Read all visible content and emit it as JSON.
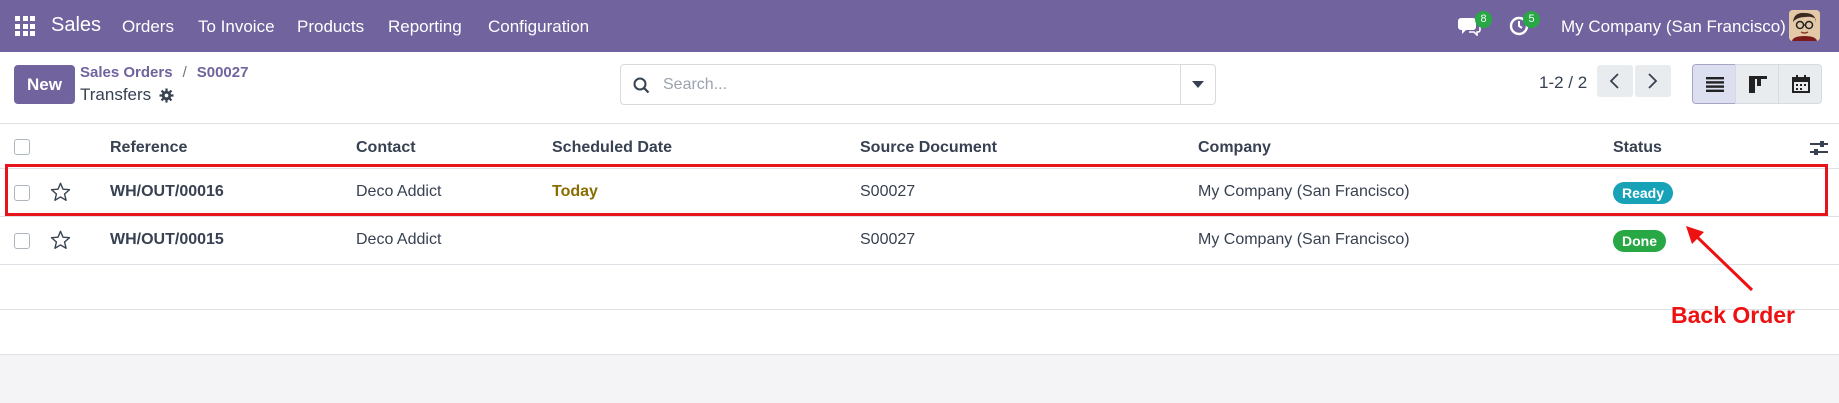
{
  "navbar": {
    "brand": "Sales",
    "menu": [
      "Orders",
      "To Invoice",
      "Products",
      "Reporting",
      "Configuration"
    ],
    "messages_count": "8",
    "activities_count": "5",
    "company": "My Company (San Francisco)"
  },
  "control": {
    "new_label": "New",
    "breadcrumb": [
      "Sales Orders",
      "S00027"
    ],
    "title": "Transfers",
    "search_placeholder": "Search...",
    "pager": "1-2 / 2"
  },
  "table": {
    "headers": [
      "Reference",
      "Contact",
      "Scheduled Date",
      "Source Document",
      "Company",
      "Status"
    ],
    "rows": [
      {
        "reference": "WH/OUT/00016",
        "contact": "Deco Addict",
        "scheduled": "Today",
        "source": "S00027",
        "company": "My Company (San Francisco)",
        "status": "Ready",
        "status_color": "#17a2b8"
      },
      {
        "reference": "WH/OUT/00015",
        "contact": "Deco Addict",
        "scheduled": "",
        "source": "S00027",
        "company": "My Company (San Francisco)",
        "status": "Done",
        "status_color": "#28a745"
      }
    ]
  },
  "annotation": {
    "label": "Back Order",
    "color": "#ee1111"
  },
  "colors": {
    "brand": "#71639e",
    "highlight": "#e8141b"
  },
  "icons": [
    "apps-icon",
    "chat-icon",
    "clock-icon",
    "gear-icon",
    "search-icon",
    "caret-down-icon",
    "chevron-left-icon",
    "chevron-right-icon",
    "list-view-icon",
    "kanban-view-icon",
    "calendar-view-icon",
    "star-icon",
    "settings-toggle-icon"
  ]
}
